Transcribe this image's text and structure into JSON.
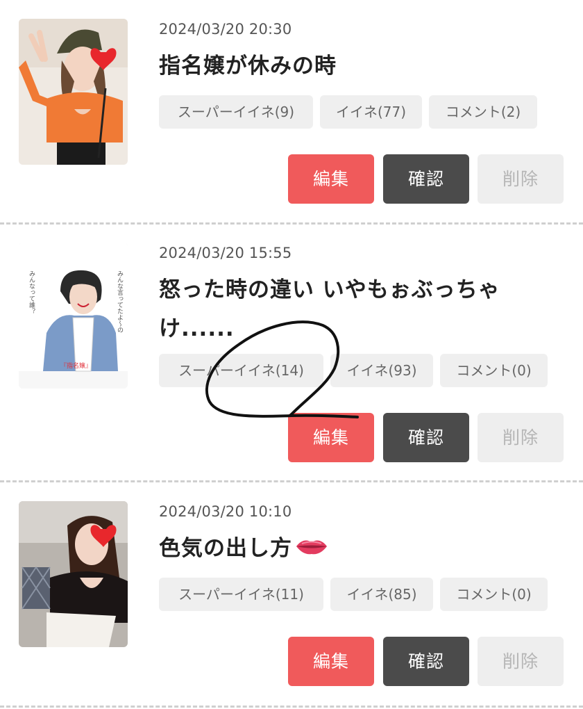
{
  "posts": [
    {
      "date": "2024/03/20 20:30",
      "title": "指名嬢が休みの時",
      "chips": {
        "super_like": "スーパーイイネ(9)",
        "like": "イイネ(77)",
        "comment": "コメント(2)"
      },
      "buttons": {
        "edit": "編集",
        "confirm": "確認",
        "delete": "削除"
      }
    },
    {
      "date": "2024/03/20 15:55",
      "title": "怒った時の違い いやもぉぶっちゃけ......",
      "thumb_text": {
        "vertical_line1": "みんな言ってたよ～の",
        "vertical_line2": "みんなって誰？",
        "label": "『指名嬢』"
      },
      "chips": {
        "super_like": "スーパーイイネ(14)",
        "like": "イイネ(93)",
        "comment": "コメント(0)"
      },
      "buttons": {
        "edit": "編集",
        "confirm": "確認",
        "delete": "削除"
      }
    },
    {
      "date": "2024/03/20 10:10",
      "title": "色気の出し方",
      "title_icon": "lips-emoji-icon",
      "chips": {
        "super_like": "スーパーイイネ(11)",
        "like": "イイネ(85)",
        "comment": "コメント(0)"
      },
      "buttons": {
        "edit": "編集",
        "confirm": "確認",
        "delete": "削除"
      }
    }
  ],
  "colors": {
    "edit": "#f05a5b",
    "confirm": "#4b4b4b",
    "delete_bg": "#eeeeee",
    "chip_bg": "#efefef",
    "divider": "#cfcfcf"
  }
}
